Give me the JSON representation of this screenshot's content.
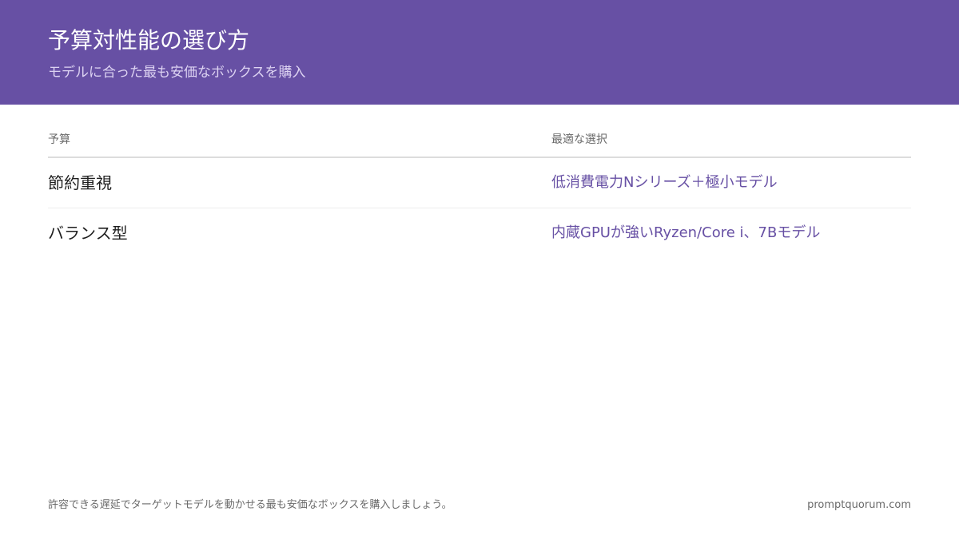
{
  "header": {
    "title": "予算対性能の選び方",
    "subtitle": "モデルに合った最も安価なボックスを購入"
  },
  "table": {
    "columns": [
      "予算",
      "最適な選択"
    ],
    "rows": [
      {
        "budget": "節約重視",
        "choice": "低消費電力Nシリーズ＋極小モデル"
      },
      {
        "budget": "バランス型",
        "choice": "内蔵GPUが強いRyzen/Core i、7Bモデル"
      }
    ]
  },
  "footer": {
    "note": "許容できる遅延でターゲットモデルを動かせる最も安価なボックスを購入しましょう。",
    "site": "promptquorum.com"
  },
  "colors": {
    "header_bg": "#6750a4",
    "accent": "#6750a4"
  }
}
